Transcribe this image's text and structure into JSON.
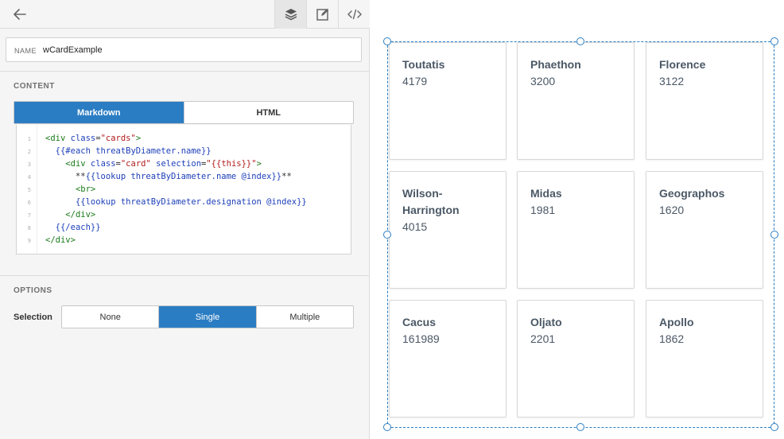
{
  "toolbar": {
    "back_icon": "arrow-left-icon",
    "layers_icon": "layers-icon",
    "edit_icon": "edit-square-icon",
    "code_icon": "code-icon"
  },
  "name": {
    "label": "NAME",
    "value": "wCardExample"
  },
  "content": {
    "title": "CONTENT",
    "tabs": [
      {
        "label": "Markdown",
        "active": true
      },
      {
        "label": "HTML",
        "active": false
      }
    ],
    "line_numbers": [
      "1",
      "2",
      "3",
      "4",
      "5",
      "6",
      "7",
      "8",
      "9"
    ]
  },
  "options": {
    "title": "OPTIONS",
    "selection_label": "Selection",
    "selection_choices": [
      {
        "label": "None",
        "active": false
      },
      {
        "label": "Single",
        "active": true
      },
      {
        "label": "Multiple",
        "active": false
      }
    ]
  },
  "cards": [
    {
      "name": "Toutatis",
      "value": "4179"
    },
    {
      "name": "Phaethon",
      "value": "3200"
    },
    {
      "name": "Florence",
      "value": "3122"
    },
    {
      "name": "Wilson-Harrington",
      "value": "4015"
    },
    {
      "name": "Midas",
      "value": "1981"
    },
    {
      "name": "Geographos",
      "value": "1620"
    },
    {
      "name": "Cacus",
      "value": "161989"
    },
    {
      "name": "Oljato",
      "value": "2201"
    },
    {
      "name": "Apollo",
      "value": "1862"
    }
  ],
  "colors": {
    "accent": "#2b7dc3",
    "card_text": "#4b5866"
  }
}
